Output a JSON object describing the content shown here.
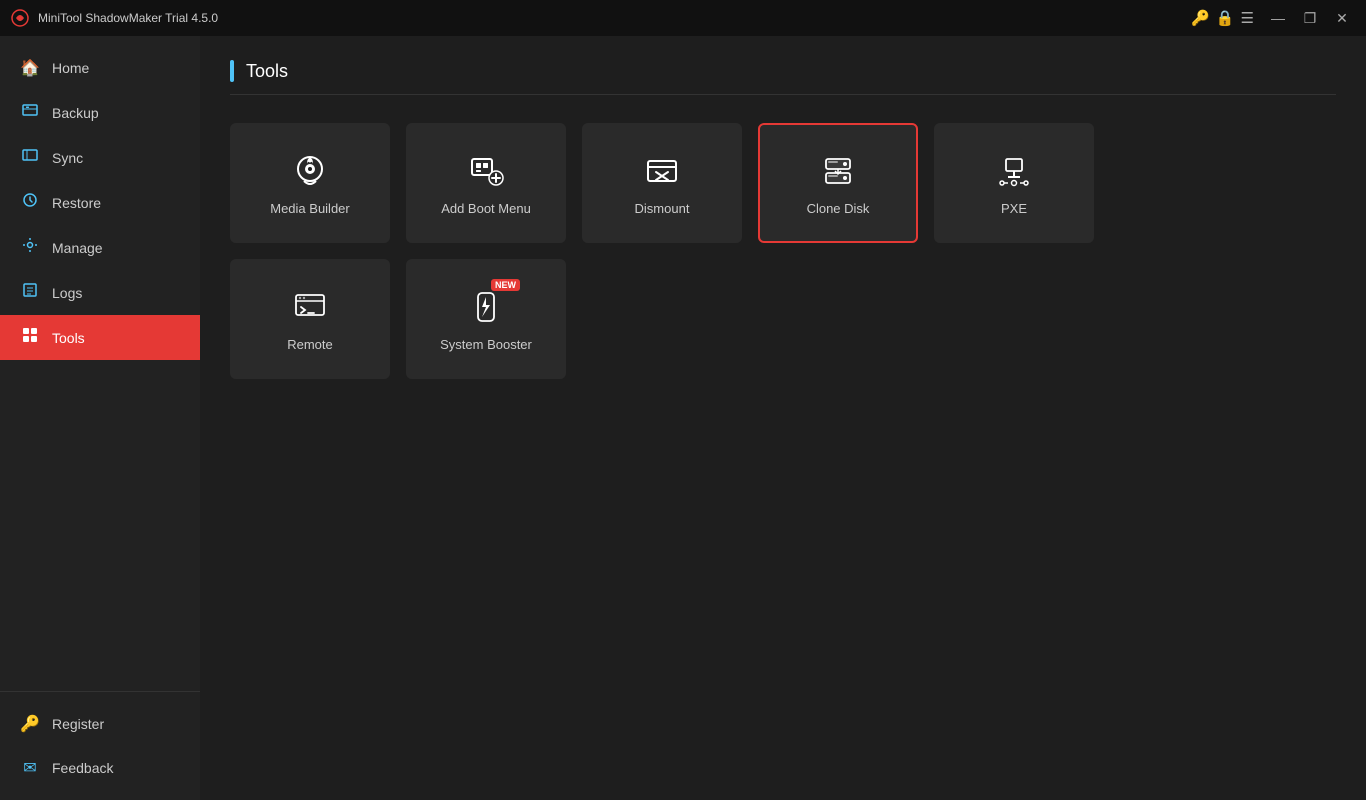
{
  "app": {
    "title": "MiniTool ShadowMaker Trial 4.5.0"
  },
  "titlebar": {
    "controls": {
      "minimize": "—",
      "restore": "❐",
      "close": "✕"
    }
  },
  "sidebar": {
    "items": [
      {
        "id": "home",
        "label": "Home",
        "icon": "🏠",
        "active": false
      },
      {
        "id": "backup",
        "label": "Backup",
        "icon": "💾",
        "active": false
      },
      {
        "id": "sync",
        "label": "Sync",
        "icon": "⇄",
        "active": false
      },
      {
        "id": "restore",
        "label": "Restore",
        "icon": "⟳",
        "active": false
      },
      {
        "id": "manage",
        "label": "Manage",
        "icon": "⚙",
        "active": false
      },
      {
        "id": "logs",
        "label": "Logs",
        "icon": "≡",
        "active": false
      },
      {
        "id": "tools",
        "label": "Tools",
        "icon": "⊞",
        "active": true
      }
    ],
    "bottom_items": [
      {
        "id": "register",
        "label": "Register",
        "icon": "🔑"
      },
      {
        "id": "feedback",
        "label": "Feedback",
        "icon": "✉"
      }
    ]
  },
  "page": {
    "title": "Tools"
  },
  "tools": [
    {
      "id": "media-builder",
      "label": "Media Builder",
      "selected": false,
      "new": false
    },
    {
      "id": "add-boot-menu",
      "label": "Add Boot Menu",
      "selected": false,
      "new": false
    },
    {
      "id": "dismount",
      "label": "Dismount",
      "selected": false,
      "new": false
    },
    {
      "id": "clone-disk",
      "label": "Clone Disk",
      "selected": true,
      "new": false
    },
    {
      "id": "pxe",
      "label": "PXE",
      "selected": false,
      "new": false
    },
    {
      "id": "remote",
      "label": "Remote",
      "selected": false,
      "new": false
    },
    {
      "id": "system-booster",
      "label": "System Booster",
      "selected": false,
      "new": true
    }
  ]
}
